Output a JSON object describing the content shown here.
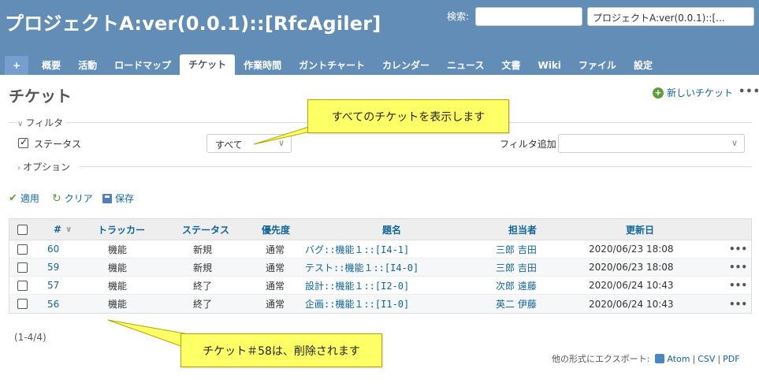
{
  "header": {
    "project_title": "プロジェクトA:ver(0.0.1)::[RfcAgiler]",
    "search_label": "検索:",
    "search_value": "",
    "project_select_value": "プロジェクトA:ver(0.0.1)::[..."
  },
  "tabs": [
    {
      "label": "+"
    },
    {
      "label": "概要"
    },
    {
      "label": "活動"
    },
    {
      "label": "ロードマップ"
    },
    {
      "label": "チケット",
      "selected": true
    },
    {
      "label": "作業時間"
    },
    {
      "label": "ガントチャート"
    },
    {
      "label": "カレンダー"
    },
    {
      "label": "ニュース"
    },
    {
      "label": "文書"
    },
    {
      "label": "Wiki"
    },
    {
      "label": "ファイル"
    },
    {
      "label": "設定"
    }
  ],
  "page": {
    "title": "チケット",
    "new_issue_label": "新しいチケット",
    "more": "•••"
  },
  "filters": {
    "legend": "フィルタ",
    "status_label": "ステータス",
    "status_checked": true,
    "status_operator": "すべて",
    "add_filter_label": "フィルタ追加",
    "add_filter_value": ""
  },
  "options": {
    "legend": "オプション"
  },
  "actions": {
    "apply": "適用",
    "clear": "クリア",
    "save": "保存"
  },
  "table": {
    "columns": [
      "#",
      "トラッカー",
      "ステータス",
      "優先度",
      "題名",
      "担当者",
      "更新日"
    ],
    "rows": [
      {
        "id": "60",
        "tracker": "機能",
        "status": "新規",
        "priority": "通常",
        "subject": "バグ::機能１::[I4-1]",
        "assignee": "三郎 吉田",
        "updated": "2020/06/23 18:08"
      },
      {
        "id": "59",
        "tracker": "機能",
        "status": "新規",
        "priority": "通常",
        "subject": "テスト::機能１::[I4-0]",
        "assignee": "三郎 吉田",
        "updated": "2020/06/23 18:08"
      },
      {
        "id": "57",
        "tracker": "機能",
        "status": "終了",
        "priority": "通常",
        "subject": "設計::機能１::[I2-0]",
        "assignee": "次郎 遠藤",
        "updated": "2020/06/24 10:43"
      },
      {
        "id": "56",
        "tracker": "機能",
        "status": "終了",
        "priority": "通常",
        "subject": "企画::機能１::[I1-0]",
        "assignee": "英二 伊藤",
        "updated": "2020/06/24 10:43"
      }
    ],
    "row_more": "•••"
  },
  "footer": {
    "count": "(1-4/4)",
    "export_label": "他の形式にエクスポート:",
    "formats": [
      "Atom",
      "CSV",
      "PDF"
    ],
    "separator": "|"
  },
  "callouts": {
    "top": "すべてのチケットを表示します",
    "bottom": "チケット＃58は、削除されます"
  },
  "colors": {
    "header_bg": "#628db6",
    "link": "#169",
    "callout_bg": "#ffff66"
  }
}
